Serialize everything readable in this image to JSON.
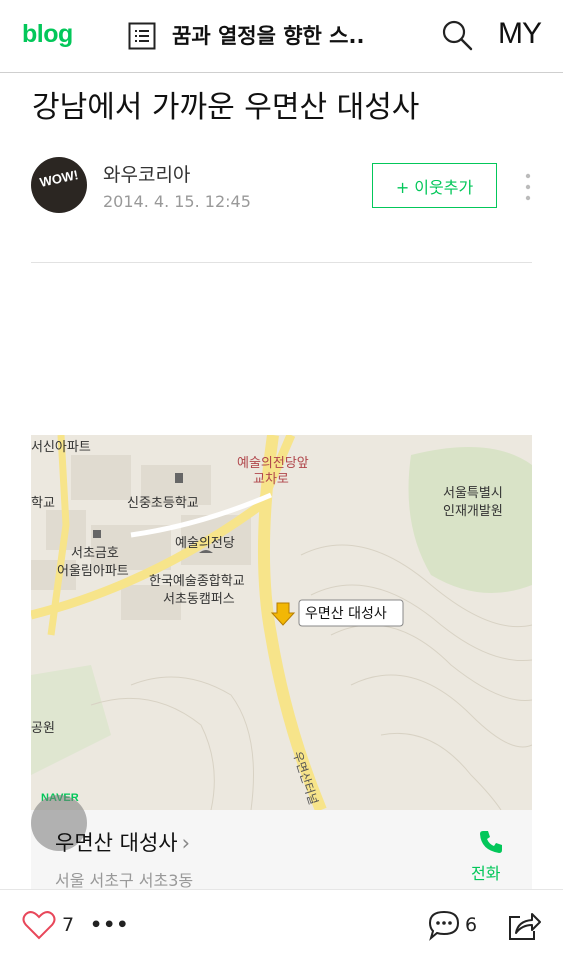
{
  "header": {
    "logo": "blog",
    "blog_title": "꿈과 열정을 향한 스..",
    "my_label": "MY",
    "list_icon": "list-icon",
    "search_icon": "search-icon"
  },
  "post": {
    "title": "강남에서 가까운 우면산 대성사",
    "author": "와우코리아",
    "date": "2014. 4. 15. 12:45",
    "avatar_text": "WOW!",
    "follow_label": "+ 이웃추가"
  },
  "map": {
    "place_name": "우면산 대성사",
    "chevron": "›",
    "address": "서울 서초구 서초3동",
    "phone_label": "전화",
    "marker_label": "우면산 대성사",
    "provider": "NAVER",
    "labels": {
      "apt_top": "서신아파트",
      "arts_center_junction_1": "예술의전당앞",
      "arts_center_junction_2": "교차로",
      "seoul_hrd_1": "서울특별시",
      "seoul_hrd_2": "인재개발원",
      "school_left": "학교",
      "sinjung_school": "신중초등학교",
      "arts_center": "예술의전당",
      "seocho_apt_1": "서초금호",
      "seocho_apt_2": "어울림아파트",
      "knua_1": "한국예술종합학교",
      "knua_2": "서초동캠퍼스",
      "park_left": "공원",
      "road": "우면산터널"
    },
    "colors": {
      "background": "#ece8df",
      "road": "#f7e48a",
      "park": "#d9e3c7"
    }
  },
  "bottom_bar": {
    "like_count": "7",
    "more": "•••",
    "comment_count": "6",
    "heart_icon": "heart-icon",
    "comment_icon": "comment-icon",
    "share_icon": "share-icon"
  },
  "colors": {
    "brand": "#03c75a",
    "like": "#e8475a"
  }
}
